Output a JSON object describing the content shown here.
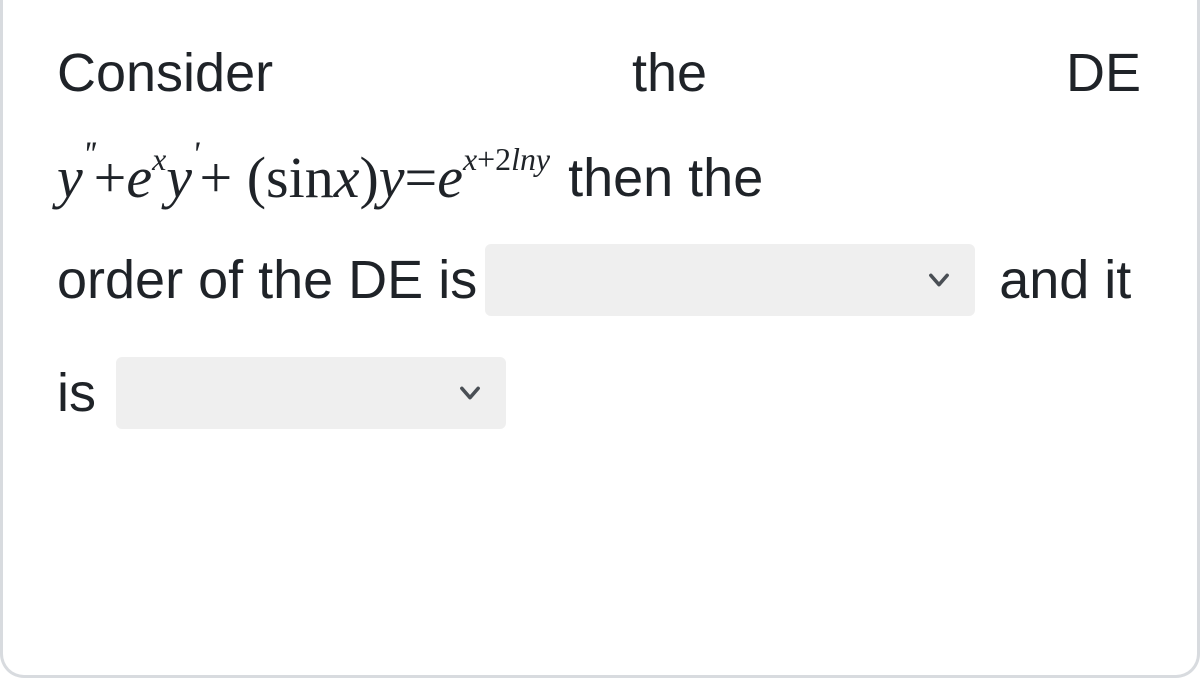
{
  "question": {
    "line1": {
      "w1": "Consider",
      "w2": "the",
      "w3": "DE"
    },
    "equation": {
      "y": "y",
      "dprime": "''",
      "plus1": "+",
      "e1": "e",
      "x_sup": "x",
      "y2": "y",
      "sprime": "'",
      "plus2": "+",
      "open": "(",
      "sin": "sin",
      "x1": "x",
      "close": ")",
      "y3": "y",
      "eq": "=",
      "e2": "e",
      "exp_x": "x",
      "exp_plus": "+",
      "exp_two": "2",
      "exp_ln": "ln",
      "exp_y": "y"
    },
    "then_the": "then  the",
    "line3_a": "order of the DE is",
    "line3_b": "and it",
    "line4_a": "is",
    "dropdowns": {
      "order_value": "",
      "linearity_value": ""
    }
  }
}
